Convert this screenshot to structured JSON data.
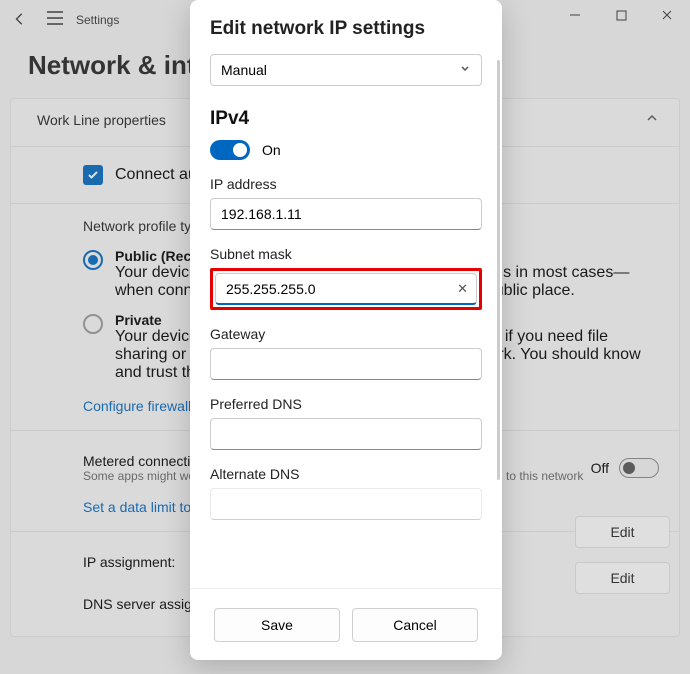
{
  "titlebar": {
    "title": "Settings"
  },
  "page_title": "Network & internet   >   Work Line",
  "card": {
    "header": "Work Line properties",
    "connect_auto": "Connect automatically when in range",
    "profile_type_label": "Network profile type",
    "public_title": "Public (Recommended)",
    "public_desc": "Your device is not discoverable on the network. Use this in most cases—when connected to a network at home, work, or in a public place.",
    "private_title": "Private",
    "private_desc": "Your device is discoverable on the network. Select this if you need file sharing or use apps that communicate over this network. You should know and trust the people and devices on the network.",
    "firewall_link": "Configure firewall and security settings",
    "metered_title": "Metered connection",
    "metered_desc": "Some apps might work differently to reduce data usage when you're connected to this network",
    "off_label": "Off",
    "data_limit_link": "Set a data limit to help control data usage on this network",
    "ip_assignment": "IP assignment:",
    "dns_assignment": "DNS server assignment:",
    "edit_label": "Edit"
  },
  "modal": {
    "title": "Edit network IP settings",
    "mode": "Manual",
    "ipv4_label": "IPv4",
    "toggle_label": "On",
    "ip_address_label": "IP address",
    "ip_address_value": "192.168.1.11",
    "subnet_label": "Subnet mask",
    "subnet_value": "255.255.255.0",
    "gateway_label": "Gateway",
    "gateway_value": "",
    "preferred_dns_label": "Preferred DNS",
    "preferred_dns_value": "",
    "alternate_dns_label": "Alternate DNS",
    "alternate_dns_value": "",
    "save": "Save",
    "cancel": "Cancel"
  }
}
